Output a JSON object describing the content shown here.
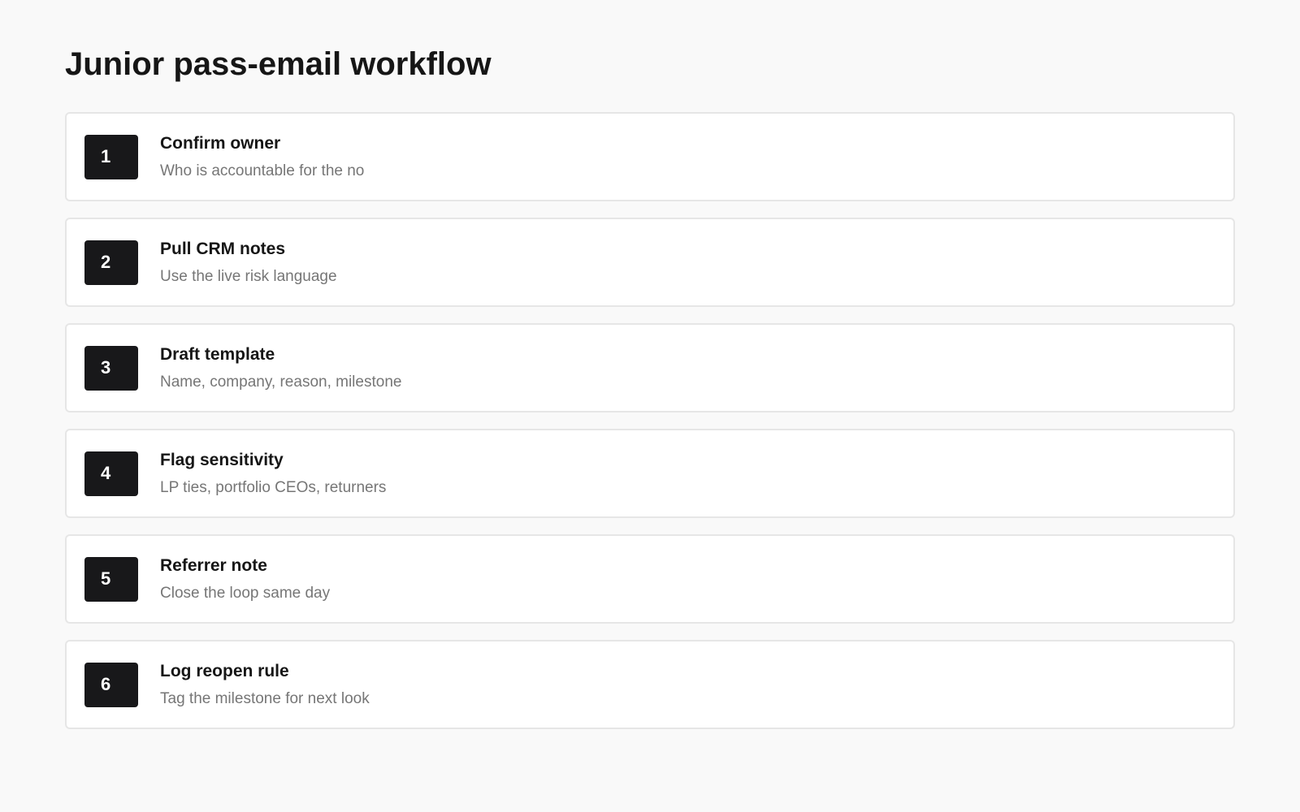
{
  "page": {
    "title": "Junior pass-email workflow"
  },
  "steps": [
    {
      "number": "1",
      "title": "Confirm owner",
      "description": "Who is accountable for the no"
    },
    {
      "number": "2",
      "title": "Pull CRM notes",
      "description": "Use the live risk language"
    },
    {
      "number": "3",
      "title": "Draft template",
      "description": "Name, company, reason, milestone"
    },
    {
      "number": "4",
      "title": "Flag sensitivity",
      "description": "LP ties, portfolio CEOs, returners"
    },
    {
      "number": "5",
      "title": "Referrer note",
      "description": "Close the loop same day"
    },
    {
      "number": "6",
      "title": "Log reopen rule",
      "description": "Tag the milestone for next look"
    }
  ]
}
